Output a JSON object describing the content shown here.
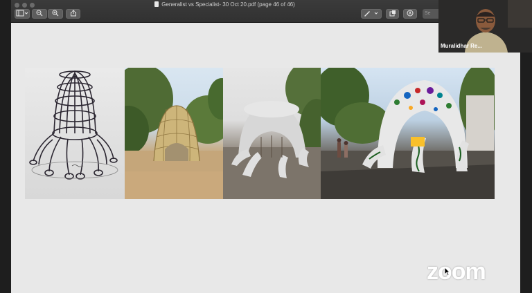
{
  "window": {
    "title": "Generalist vs Specialist- 30 Oct 20.pdf (page 46 of 46)"
  },
  "toolbar": {
    "sidebar_icon": "sidebar-toggle-icon",
    "zoom_out_icon": "zoom-out-icon",
    "zoom_in_icon": "zoom-in-icon",
    "share_icon": "share-icon",
    "markup_icon": "pen-icon",
    "rotate_icon": "rotate-icon",
    "annotate_icon": "annotate-icon",
    "search_placeholder": "Se"
  },
  "participant": {
    "name": "Muralidhar Re..."
  },
  "watermark": {
    "text": "zoom"
  },
  "colors": {
    "titlebar": "#333333",
    "page": "#e8e8e8",
    "background": "#1e1e1e"
  }
}
